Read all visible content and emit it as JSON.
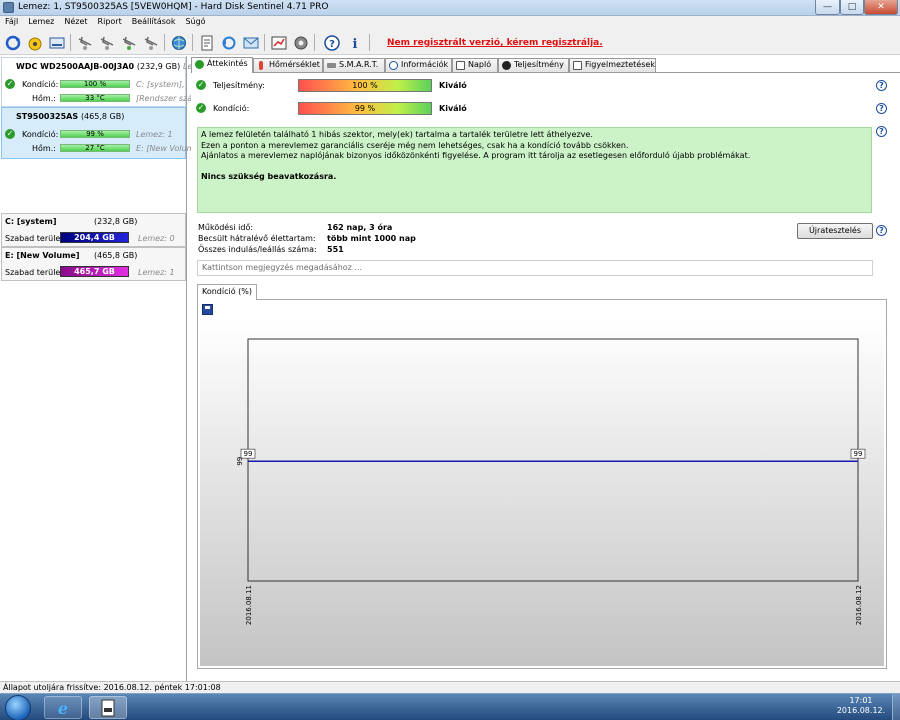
{
  "window": {
    "title": "Lemez: 1, ST9500325AS [5VEW0HQM]  -  Hard Disk Sentinel 4.71 PRO",
    "minimize_icon": "minimize-icon",
    "maximize_icon": "maximize-icon",
    "close_icon": "close-icon"
  },
  "menu": {
    "items": [
      "Fájl",
      "Lemez",
      "Nézet",
      "Riport",
      "Beállítások",
      "Súgó"
    ]
  },
  "toolbar": {
    "icons": [
      "refresh-icon",
      "test-icon",
      "disk-icon",
      "satellite-1-icon",
      "satellite-2-icon",
      "satellite-3-icon",
      "satellite-4-icon",
      "globe-icon",
      "report-icon",
      "restore-icon",
      "send-icon",
      "chart-icon",
      "settings-icon",
      "help-icon",
      "info-icon"
    ],
    "register_link": "Nem regisztrált verzió, kérem regisztrálja."
  },
  "disks": [
    {
      "name": "WDC WD2500AAJB-00J3A0",
      "size": "(232,9 GB)",
      "suffix": "Lem",
      "condition_label": "Kondíció:",
      "condition_value": "100 %",
      "condition_fraction": 1.0,
      "temp_label": "Hőm.:",
      "temp_value": "33 °C",
      "side_1": "C: [system],",
      "side_2": "[Rendszer szá"
    },
    {
      "name": "ST9500325AS",
      "size": "(465,8 GB)",
      "condition_label": "Kondíció:",
      "condition_value": "99 %",
      "condition_fraction": 0.99,
      "temp_label": "Hőm.:",
      "temp_value": "27 °C",
      "side_1": "Lemez: 1",
      "side_2": "E: [New Volum"
    }
  ],
  "partitions": [
    {
      "name": "C: [system]",
      "size": "(232,8 GB)",
      "free_label": "Szabad terület",
      "free_value": "204,4 GB",
      "disk": "Lemez: 0",
      "color": "#1b1bb0"
    },
    {
      "name": "E: [New Volume]",
      "size": "(465,8 GB)",
      "free_label": "Szabad terület",
      "free_value": "465,7 GB",
      "disk": "Lemez: 1",
      "color": "#c21ec2"
    }
  ],
  "tabs": [
    "Áttekintés",
    "Hőmérséklet",
    "S.M.A.R.T.",
    "Információk",
    "Napló",
    "Teljesítmény",
    "Figyelmeztetések"
  ],
  "overview": {
    "performance_label": "Teljesítmény:",
    "performance_value": "100 %",
    "performance_rating": "Kiváló",
    "condition_label": "Kondíció:",
    "condition_value": "99 %",
    "condition_rating": "Kiváló",
    "message_lines": [
      "A lemez felületén található 1 hibás szektor, mely(ek) tartalma a tartalék területre lett áthelyezve.",
      "Ezen a ponton a merevlemez garanciális cseréje még nem lehetséges, csak ha a kondíció tovább csökken.",
      "Ajánlatos a merevlemez naplójának bizonyos időközönkénti figyelése. A program itt tárolja az esetlegesen előforduló újabb problémákat."
    ],
    "message_bold": "Nincs szükség beavatkozásra.",
    "uptime_label": "Működési idő:",
    "uptime_value": "162 nap, 3 óra",
    "lifetime_label": "Becsült hátralévő élettartam:",
    "lifetime_value": "több mint 1000 nap",
    "startstop_label": "Összes indulás/leállás száma:",
    "startstop_value": "551",
    "retest_button": "Újratesztelés",
    "note_placeholder": "Kattintson megjegyzés megadásához ...",
    "help_icon": "help-icon"
  },
  "chart_tab": "Kondíció  (%)",
  "chart_data": {
    "type": "line",
    "x": [
      "2016.08.11",
      "2016.08.12"
    ],
    "series": [
      {
        "values": [
          99,
          99
        ],
        "color": "#1a1aa8"
      }
    ],
    "point_labels": [
      "99",
      "99"
    ],
    "ytick": "99",
    "grid": false
  },
  "statusbar": "Állapot utoljára frissítve: 2016.08.12. péntek 17:01:08",
  "taskbar": {
    "start_icon": "windows-start-icon",
    "apps": [
      "internet-explorer-icon",
      "hard-disk-sentinel-icon"
    ],
    "time": "17:01",
    "date": "2016.08.12."
  }
}
